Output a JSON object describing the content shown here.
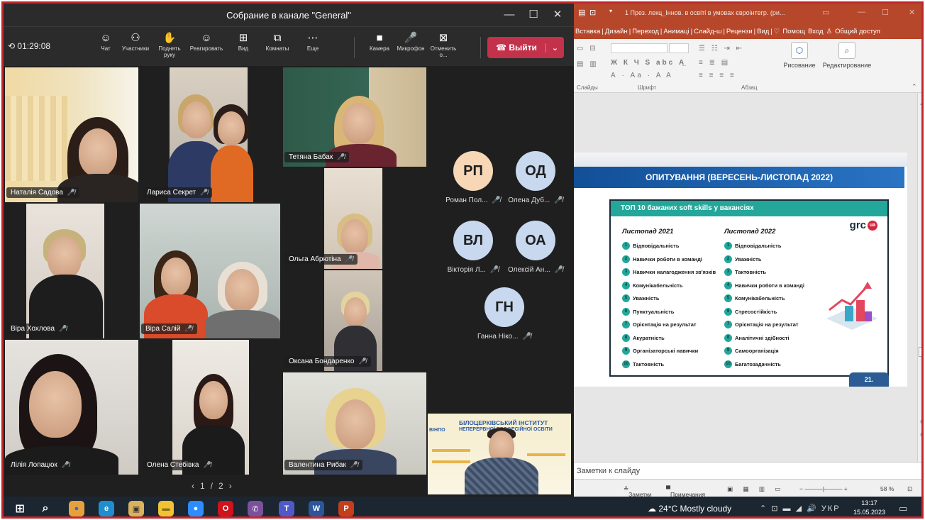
{
  "teams": {
    "title": "Собрание в канале \"General\"",
    "window_controls": [
      "—",
      "☐",
      "✕"
    ],
    "timer": "01:29:08",
    "toolbar": [
      {
        "label": "Чат",
        "icon": "chat-icon",
        "glyph": "☺"
      },
      {
        "label": "Участники",
        "icon": "participants-icon",
        "glyph": "⚇"
      },
      {
        "label": "Поднять руку",
        "icon": "raise-hand-icon",
        "glyph": "✋"
      },
      {
        "label": "Реагировать",
        "icon": "react-icon",
        "glyph": "☺"
      },
      {
        "label": "Вид",
        "icon": "view-icon",
        "glyph": "⊞"
      },
      {
        "label": "Комнаты",
        "icon": "rooms-icon",
        "glyph": "⧉"
      },
      {
        "label": "Еще",
        "icon": "more-icon",
        "glyph": "⋯"
      },
      {
        "label": "Камера",
        "icon": "camera-icon",
        "glyph": "■"
      },
      {
        "label": "Микрофон",
        "icon": "microphone-icon",
        "glyph": "🎤"
      },
      {
        "label": "Отменить о...",
        "icon": "share-icon",
        "glyph": "⊠"
      }
    ],
    "leave_label": "Выйти",
    "leave_chevron": "⌄",
    "mic_off": "🎤̸",
    "tiles": [
      {
        "name": "Наталія Садова"
      },
      {
        "name": "Лариса Секрет"
      },
      {
        "name": "Тетяна Бабак"
      },
      {
        "name": "Віра Хохлова"
      },
      {
        "name": "Віра Салій"
      },
      {
        "name": "Ольга Абрютіна"
      },
      {
        "name": "Оксана Бондаренко"
      },
      {
        "name": "Лілія Лопацюк"
      },
      {
        "name": "Олена Стебівка"
      },
      {
        "name": "Валентина Рибак"
      }
    ],
    "avatars": [
      {
        "initials": "РП",
        "name": "Роман Пол...",
        "color": "#f8d7b6"
      },
      {
        "initials": "ОД",
        "name": "Олена Дуб...",
        "color": "#c7d8ef"
      },
      {
        "initials": "ВЛ",
        "name": "Вікторія Л...",
        "color": "#c7d8ef"
      },
      {
        "initials": "ОА",
        "name": "Олексій Ан...",
        "color": "#c7d8ef"
      },
      {
        "initials": "ГН",
        "name": "Ганна Ніко...",
        "color": "#c7d8ef"
      }
    ],
    "pager": {
      "prev": "‹",
      "page": "1/2",
      "next": "›"
    },
    "self_view": {
      "banner_line1": "БІЛОЦЕРКІВСЬКИЙ ІНСТИТУТ",
      "banner_line2": "НЕПЕРЕРВНОЇ ПРОФЕСІЙНОЇ ОСВІТИ",
      "logo": "ВІНПО"
    }
  },
  "ppt": {
    "title": "1 През. лекц_Іннов. в освіті в умовах євроінтегр. (ри...",
    "menu": [
      "Вставка",
      "Дизайн",
      "Переход",
      "Анимаці",
      "Слайд-ш",
      "Рецензи",
      "Вид"
    ],
    "help": "Помощ",
    "login": "Вход",
    "share": "Общий доступ",
    "ribbon": {
      "groups": [
        "Слайды",
        "Шрифт",
        "Абзац"
      ],
      "draw": "Рисование",
      "edit": "Редактирование",
      "font_row": "Ж К Ч S abc А̲",
      "font_row2": "А · Аа · A A"
    },
    "slide": {
      "header": "ОПИТУВАННЯ (ВЕРЕСЕНЬ-ЛИСТОПАД 2022)",
      "card_title": "ТОП 10 бажаних soft skills у вакансіях",
      "brand": "grc",
      "brand_badge": "ua",
      "col1_title": "Листопад 2021",
      "col2_title": "Листопад 2022",
      "col1": [
        "Відповідальність",
        "Навички роботи в команді",
        "Навички налагодження зв'язків",
        "Комунікабельність",
        "Уважність",
        "Пунктуальність",
        "Орієнтація на результат",
        "Акуратність",
        "Організаторські навички",
        "Тактовність"
      ],
      "col2": [
        "Відповідальність",
        "Уважність",
        "Тактовність",
        "Навички роботи в команді",
        "Комунікабельність",
        "Стресостійкість",
        "Орієнтація на результат",
        "Аналітичні здібності",
        "Самоорганізація",
        "Багатозадачність"
      ],
      "number": "21."
    },
    "notes_label": "Заметки к слайду",
    "status": {
      "notes": "Заметки",
      "comments": "Примечания",
      "zoom": "58 %"
    }
  },
  "taskbar": {
    "weather": "24°C  Mostly cloudy",
    "lang": "УКР",
    "time": "13:17",
    "date": "15.05.2023",
    "apps": [
      {
        "name": "windows-start-icon",
        "glyph": "⊞",
        "bg": "transparent",
        "fg": "#fff"
      },
      {
        "name": "search-icon",
        "glyph": "⌕",
        "bg": "transparent",
        "fg": "#fff"
      },
      {
        "name": "chrome-icon",
        "glyph": "●",
        "bg": "#e8a13a",
        "fg": "#2d6ad1"
      },
      {
        "name": "edge-icon",
        "glyph": "e",
        "bg": "#1d8fd1",
        "fg": "#fff"
      },
      {
        "name": "photos-icon",
        "glyph": "▣",
        "bg": "#d9b25e",
        "fg": "#333"
      },
      {
        "name": "file-explorer-icon",
        "glyph": "▬",
        "bg": "#f1c232",
        "fg": "#8a6d16"
      },
      {
        "name": "zoom-icon",
        "glyph": "●",
        "bg": "#2d8cff",
        "fg": "#fff"
      },
      {
        "name": "opera-icon",
        "glyph": "O",
        "bg": "#d0121c",
        "fg": "#fff"
      },
      {
        "name": "viber-icon",
        "glyph": "✆",
        "bg": "#7b519d",
        "fg": "#fff"
      },
      {
        "name": "teams-icon",
        "glyph": "T",
        "bg": "#5059c9",
        "fg": "#fff"
      },
      {
        "name": "word-icon",
        "glyph": "W",
        "bg": "#2b579a",
        "fg": "#fff"
      },
      {
        "name": "powerpoint-icon",
        "glyph": "P",
        "bg": "#c43e1c",
        "fg": "#fff"
      }
    ]
  }
}
